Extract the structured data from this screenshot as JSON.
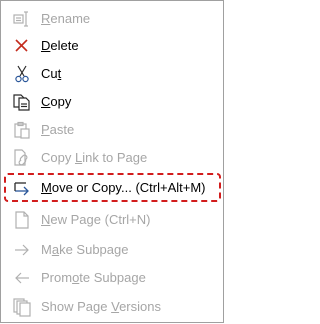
{
  "menu": {
    "items": [
      {
        "pre": "",
        "acc": "R",
        "post": "ename",
        "shortcut": "",
        "icon": "rename-icon",
        "enabled": false
      },
      {
        "pre": "",
        "acc": "D",
        "post": "elete",
        "shortcut": "",
        "icon": "delete-icon",
        "enabled": true
      },
      {
        "pre": "Cu",
        "acc": "t",
        "post": "",
        "shortcut": "",
        "icon": "scissors-icon",
        "enabled": true
      },
      {
        "pre": "",
        "acc": "C",
        "post": "opy",
        "shortcut": "",
        "icon": "copy-icon",
        "enabled": true
      },
      {
        "pre": "",
        "acc": "P",
        "post": "aste",
        "shortcut": "",
        "icon": "paste-icon",
        "enabled": false
      },
      {
        "pre": "Copy ",
        "acc": "L",
        "post": "ink to Page",
        "shortcut": "",
        "icon": "link-icon",
        "enabled": false
      },
      {
        "pre": "",
        "acc": "M",
        "post": "ove or Copy...",
        "shortcut": "(Ctrl+Alt+M)",
        "icon": "move-icon",
        "enabled": true
      },
      {
        "pre": "",
        "acc": "N",
        "post": "ew Page",
        "shortcut": "(Ctrl+N)",
        "icon": "new-page-icon",
        "enabled": false
      },
      {
        "pre": "M",
        "acc": "a",
        "post": "ke Subpage",
        "shortcut": "",
        "icon": "arrow-right-icon",
        "enabled": false
      },
      {
        "pre": "Prom",
        "acc": "o",
        "post": "te Subpage",
        "shortcut": "",
        "icon": "arrow-left-icon",
        "enabled": false
      },
      {
        "pre": "Show Page ",
        "acc": "V",
        "post": "ersions",
        "shortcut": "",
        "icon": "versions-icon",
        "enabled": false
      }
    ]
  },
  "colors": {
    "highlight_border": "#d21c1c",
    "disabled_text": "#a6a6a6",
    "delete_icon": "#c42b1c",
    "link_icon": "#2b579a"
  }
}
